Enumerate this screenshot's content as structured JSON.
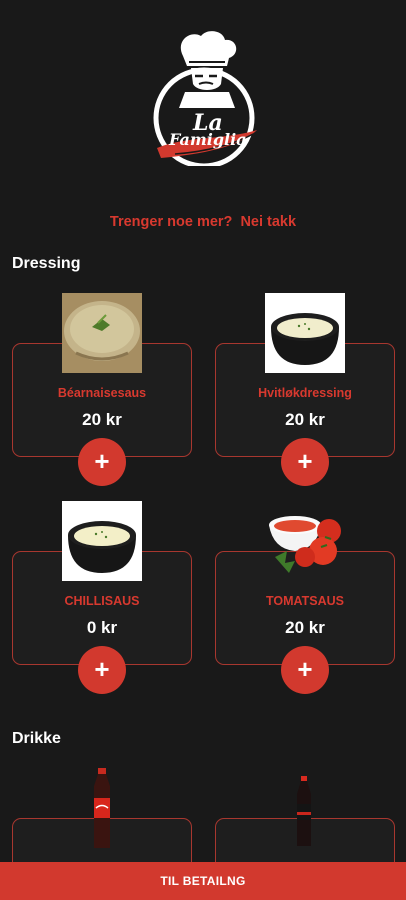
{
  "logo": {
    "line1": "La",
    "line2": "Famiglia"
  },
  "prompt": {
    "question": "Trenger noe mer?",
    "decline": "Nei takk"
  },
  "sections": {
    "dressing": {
      "title": "Dressing",
      "items": [
        {
          "name": "Béarnaisesaus",
          "price": "20 kr",
          "image": "bearnaise-bowl"
        },
        {
          "name": "Hvitløkdressing",
          "price": "20 kr",
          "image": "garlic-dressing-bowl"
        },
        {
          "name": "CHILLISAUS",
          "price": "0 kr",
          "image": "chili-sauce-bowl"
        },
        {
          "name": "TOMATSAUS",
          "price": "20 kr",
          "image": "tomato-sauce-bowl"
        }
      ],
      "add_label": "+"
    },
    "drikke": {
      "title": "Drikke"
    }
  },
  "footer": {
    "label": "TIL BETAILNG"
  },
  "colors": {
    "background": "#191919",
    "accent": "#d2392e",
    "border": "#a8372f"
  }
}
